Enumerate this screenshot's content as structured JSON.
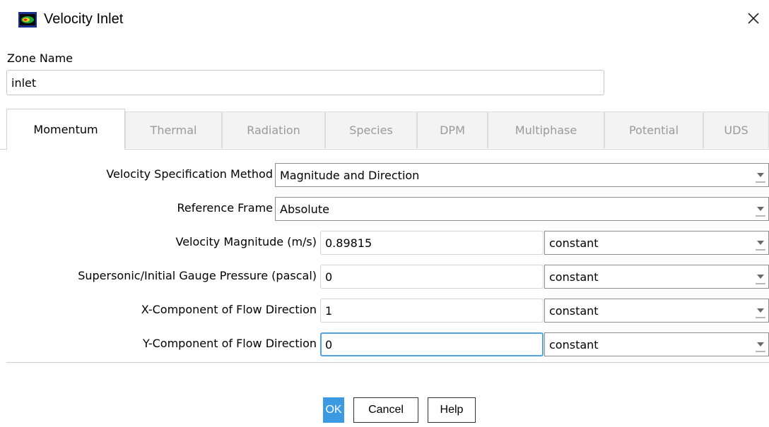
{
  "window": {
    "title": "Velocity Inlet",
    "icon": "fluent-app-icon",
    "close_icon": "close-icon"
  },
  "zone": {
    "label": "Zone Name",
    "value": "inlet"
  },
  "tabs": [
    {
      "label": "Momentum",
      "active": true
    },
    {
      "label": "Thermal",
      "active": false
    },
    {
      "label": "Radiation",
      "active": false
    },
    {
      "label": "Species",
      "active": false
    },
    {
      "label": "DPM",
      "active": false
    },
    {
      "label": "Multiphase",
      "active": false
    },
    {
      "label": "Potential",
      "active": false
    },
    {
      "label": "UDS",
      "active": false
    }
  ],
  "momentum": {
    "velocity_spec": {
      "label": "Velocity Specification Method",
      "value": "Magnitude and Direction"
    },
    "reference_frame": {
      "label": "Reference Frame",
      "value": "Absolute"
    },
    "fields": [
      {
        "label": "Velocity Magnitude (m/s)",
        "value": "0.89815",
        "profile": "constant"
      },
      {
        "label": "Supersonic/Initial Gauge Pressure (pascal)",
        "value": "0",
        "profile": "constant"
      },
      {
        "label": "X-Component of Flow Direction",
        "value": "1",
        "profile": "constant"
      },
      {
        "label": "Y-Component of Flow Direction",
        "value": "0",
        "profile": "constant",
        "focused": true
      }
    ]
  },
  "buttons": {
    "ok": "OK",
    "cancel": "Cancel",
    "help": "Help"
  },
  "colors": {
    "accent": "#3c9ae2",
    "focus_border": "#55a1e6",
    "inactive_tab_text": "#9a9a9a"
  }
}
